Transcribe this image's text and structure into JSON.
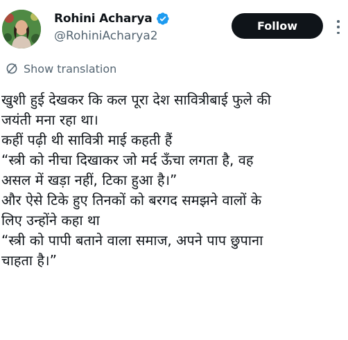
{
  "author": {
    "display_name": "Rohini Acharya",
    "handle": "@RohiniAcharya2",
    "verified": true,
    "avatar_icon": "profile-photo"
  },
  "actions": {
    "follow_label": "Follow",
    "more_icon": "more-vertical-icon"
  },
  "translation": {
    "label": "Show translation",
    "icon": "translate-icon"
  },
  "tweet": {
    "lines": [
      "खुशी हुई देखकर कि कल पूरा देश सावित्रीबाई फुले की",
      "जयंती मना रहा था।",
      "कहीं पढ़ी थी सावित्री माई कहती हैं",
      "“स्त्री को नीचा दिखाकर जो मर्द ऊँचा लगता है, वह",
      "असल में खड़ा नहीं, टिका हुआ है।”",
      "और ऐसे टिके हुए तिनकों को बरगद समझने वालों के",
      "लिए उन्होंने कहा था",
      "“स्त्री को पापी बताने वाला समाज, अपने पाप छुपाना",
      "चाहता है।”"
    ]
  },
  "colors": {
    "verified_badge": "#1d9bf0",
    "follow_bg": "#0f1419",
    "secondary_text": "#536471"
  }
}
